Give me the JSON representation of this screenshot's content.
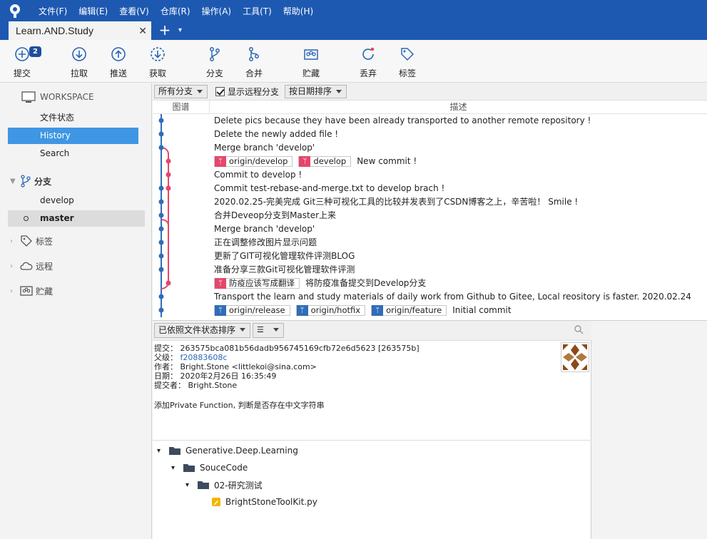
{
  "menu": [
    "文件(F)",
    "编辑(E)",
    "查看(V)",
    "仓库(R)",
    "操作(A)",
    "工具(T)",
    "帮助(H)"
  ],
  "tab": {
    "title": "Learn.AND.Study",
    "close": "✕",
    "add": "+",
    "more": "▾"
  },
  "toolbar": {
    "commit": "提交",
    "commit_badge": "2",
    "pull": "拉取",
    "push": "推送",
    "fetch": "获取",
    "branch": "分支",
    "merge": "合并",
    "stash": "贮藏",
    "discard": "丢弃",
    "tag": "标签"
  },
  "sidebar": {
    "workspace": "WORKSPACE",
    "ws_items": [
      "文件状态",
      "History",
      "Search"
    ],
    "branches": "分支",
    "branch_items": [
      "develop",
      "master"
    ],
    "tags": "标签",
    "remotes": "远程",
    "stashes": "贮藏"
  },
  "history": {
    "branch_filter": "所有分支",
    "show_remote": "显示远程分支",
    "sort": "按日期排序",
    "col_graph": "图谱",
    "col_desc": "描述",
    "commits": [
      {
        "tags": [],
        "msg": "Delete pics because they have been already transported to another remote repository !"
      },
      {
        "tags": [],
        "msg": "Delete the newly added file !"
      },
      {
        "tags": [],
        "msg": "Merge branch 'develop'"
      },
      {
        "tags": [
          {
            "name": "origin/develop",
            "kind": "pink"
          },
          {
            "name": "develop",
            "kind": "pink"
          }
        ],
        "msg": "New commit !"
      },
      {
        "tags": [],
        "msg": "Commit to develop !"
      },
      {
        "tags": [],
        "msg": "Commit test-rebase-and-merge.txt to develop brach !"
      },
      {
        "tags": [],
        "msg": "2020.02.25-完美完成 Git三种可视化工具的比较并发表到了CSDN博客之上，辛苦啦！ Smile !"
      },
      {
        "tags": [],
        "msg": "合并Deveop分支到Master上来"
      },
      {
        "tags": [],
        "msg": "Merge branch 'develop'"
      },
      {
        "tags": [],
        "msg": "正在调整修改图片显示问题"
      },
      {
        "tags": [],
        "msg": "更新了GIT可视化管理软件评测BLOG"
      },
      {
        "tags": [],
        "msg": "准备分享三款Git可视化管理软件评测"
      },
      {
        "tags": [
          {
            "name": "防疫应该写成翻译",
            "kind": "pink"
          }
        ],
        "msg": "将防疫准备提交到Develop分支"
      },
      {
        "tags": [],
        "msg": "Transport the learn and study materials of daily work from Github to Gitee, Local reository is faster. 2020.02.24"
      },
      {
        "tags": [
          {
            "name": "origin/release",
            "kind": "blue"
          },
          {
            "name": "origin/hotfix",
            "kind": "blue"
          },
          {
            "name": "origin/feature",
            "kind": "blue"
          }
        ],
        "msg": "Initial commit"
      }
    ]
  },
  "details": {
    "sort": "已依照文件状态排序",
    "commit_label": "提交：",
    "commit_value": "263575bca081b56dadb956745169cfb72e6d5623 [263575b]",
    "parent_label": "父级：",
    "parent_value": "f20883608c",
    "author_label": "作者：",
    "author_value": "Bright.Stone <littlekoi@sina.com>",
    "date_label": "日期：",
    "date_value": "2020年2月26日 16:35:49",
    "committer_label": "提交者：",
    "committer_value": "Bright.Stone",
    "message": "添加Private Function, 判断是否存在中文字符串"
  },
  "tree": {
    "root": "Generative.Deep.Learning",
    "sub": "SouceCode",
    "sub2": "02-研究测试",
    "file": "BrightStoneToolKit.py"
  },
  "colors": {
    "accent": "#1d59b1",
    "selected": "#3f96e4",
    "pink_branch": "#e4476a",
    "blue_branch": "#2f6db8"
  }
}
